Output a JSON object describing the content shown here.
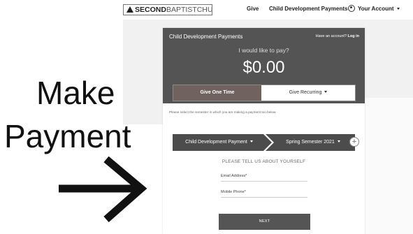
{
  "header": {
    "logo_strong": "SECOND",
    "logo_light": "BAPTISTCHURCH",
    "nav": [
      "Give",
      "Child Development Payments",
      "Your Account"
    ]
  },
  "card": {
    "title": "Child Development Payments",
    "login_prefix": "Have an account?",
    "login_link": "Log in",
    "would_like": "I would like to pay?",
    "amount": "$0.00",
    "give_one_time": "Give One Time",
    "give_recurring": "Give Recurring",
    "note": "Please select the semester in which you are making a payment too below.",
    "fund": "Child Development Payment",
    "semester": "Spring Semester 2021",
    "tell_us": "PLEASE TELL US ABOUT YOURSELF",
    "email_label": "Email Address*",
    "phone_label": "Mobile Phone*",
    "next": "NEXT"
  },
  "overlay": {
    "line1": "Make",
    "line2": "Payment"
  },
  "icons": {
    "logo": "triangle-logo-icon",
    "account": "user-circle-icon",
    "dropdown": "chevron-down-icon",
    "step_sep": "chevron-right-icon",
    "add": "plus-icon",
    "pointer": "arrow-right-icon"
  }
}
